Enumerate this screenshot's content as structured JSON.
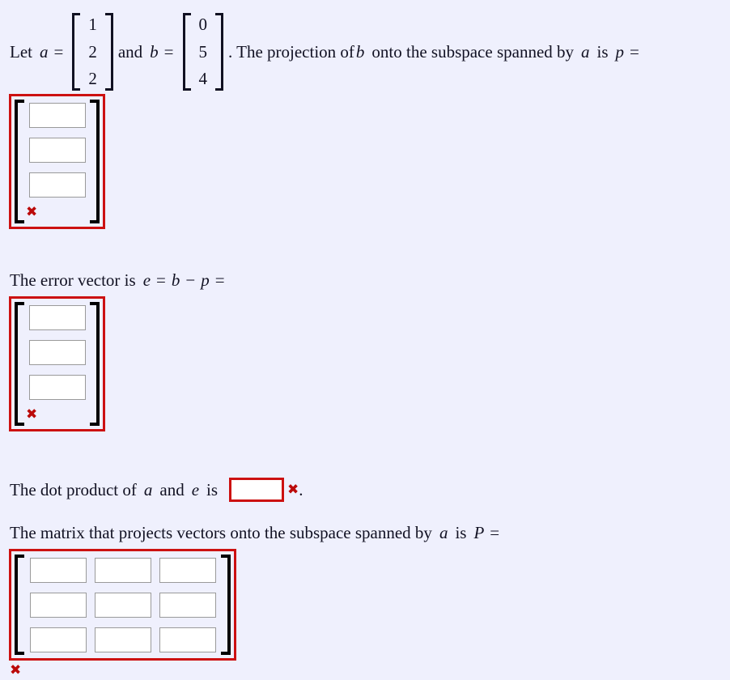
{
  "page": {
    "background_color": "#eff0fd",
    "text_color": "#111122",
    "error_color": "#bb0a0a",
    "answer_border_color": "#cc1111"
  },
  "problem": {
    "line1": {
      "prefix": "Let",
      "var_a": "a",
      "equals": "=",
      "vector_a": [
        "1",
        "2",
        "2"
      ],
      "conjunction": "and",
      "var_b": "b",
      "equals2": "=",
      "vector_b": [
        "0",
        "5",
        "4"
      ],
      "sentence_part1": ". The projection of",
      "var_b2": "b",
      "sentence_part2": "onto the subspace spanned by",
      "var_a2": "a",
      "sentence_part3": "is",
      "var_p": "p",
      "equals3": "="
    },
    "line2": {
      "text_prefix": "The error vector is",
      "var_e": "e",
      "equals": "=",
      "var_b": "b",
      "minus": "−",
      "var_p": "p",
      "equals2": "="
    },
    "line3": {
      "text_prefix": "The dot product of",
      "var_a": "a",
      "conjunction": "and",
      "var_e": "e",
      "text_suffix": "is",
      "period": "."
    },
    "line4": {
      "text_prefix": "The matrix that projects vectors onto the subspace spanned by",
      "var_a": "a",
      "text_suffix": "is",
      "var_P": "P",
      "equals": "="
    }
  },
  "answers": {
    "projection_vector": {
      "label": "p",
      "rows": 3,
      "cols": 1,
      "values": [
        "",
        "",
        ""
      ],
      "placeholder": "",
      "status": "incorrect",
      "status_icon": "x-mark-icon",
      "status_glyph": "✖"
    },
    "error_vector": {
      "label": "e",
      "rows": 3,
      "cols": 1,
      "values": [
        "",
        "",
        ""
      ],
      "placeholder": "",
      "status": "incorrect",
      "status_icon": "x-mark-icon",
      "status_glyph": "✖"
    },
    "dot_product": {
      "label": "a dot e",
      "value": "",
      "placeholder": "",
      "status": "incorrect",
      "status_icon": "x-mark-icon",
      "status_glyph": "✖"
    },
    "projection_matrix": {
      "label": "P",
      "rows": 3,
      "cols": 3,
      "values": [
        [
          "",
          "",
          ""
        ],
        [
          "",
          "",
          ""
        ],
        [
          "",
          "",
          ""
        ]
      ],
      "placeholder": "",
      "status": "incorrect",
      "status_icon": "x-mark-icon",
      "status_glyph": "✖"
    }
  }
}
